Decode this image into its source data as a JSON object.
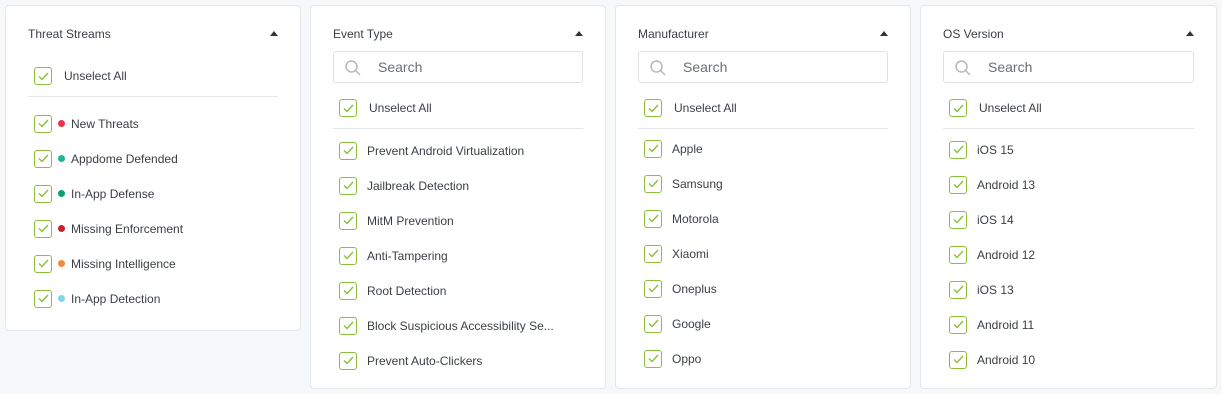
{
  "colors": {
    "checkbox_border": "#8bbf3a",
    "check": "#8bbf3a"
  },
  "panels": [
    {
      "title": "Threat Streams",
      "has_search": false,
      "select_all_label": "Unselect All",
      "items": [
        {
          "label": "New Threats",
          "dot_color": "#e8344e"
        },
        {
          "label": "Appdome Defended",
          "dot_color": "#19b98d"
        },
        {
          "label": "In-App Defense",
          "dot_color": "#0e9f73"
        },
        {
          "label": "Missing Enforcement",
          "dot_color": "#cc1f2c"
        },
        {
          "label": "Missing Intelligence",
          "dot_color": "#f08a3c"
        },
        {
          "label": "In-App Detection",
          "dot_color": "#7fd6ec"
        }
      ]
    },
    {
      "title": "Event Type",
      "has_search": true,
      "search_placeholder": "Search",
      "select_all_label": "Unselect All",
      "items": [
        {
          "label": "Prevent Android Virtualization"
        },
        {
          "label": "Jailbreak Detection"
        },
        {
          "label": "MitM Prevention"
        },
        {
          "label": "Anti-Tampering"
        },
        {
          "label": "Root Detection"
        },
        {
          "label": "Block Suspicious Accessibility Se..."
        },
        {
          "label": "Prevent Auto-Clickers"
        }
      ]
    },
    {
      "title": "Manufacturer",
      "has_search": true,
      "search_placeholder": "Search",
      "select_all_label": "Unselect All",
      "items": [
        {
          "label": "Apple"
        },
        {
          "label": "Samsung"
        },
        {
          "label": "Motorola"
        },
        {
          "label": "Xiaomi"
        },
        {
          "label": "Oneplus"
        },
        {
          "label": "Google"
        },
        {
          "label": "Oppo"
        }
      ]
    },
    {
      "title": "OS Version",
      "has_search": true,
      "search_placeholder": "Search",
      "select_all_label": "Unselect All",
      "items": [
        {
          "label": "iOS 15"
        },
        {
          "label": "Android 13"
        },
        {
          "label": "iOS 14"
        },
        {
          "label": "Android 12"
        },
        {
          "label": "iOS 13"
        },
        {
          "label": "Android 11"
        },
        {
          "label": "Android 10"
        }
      ]
    }
  ]
}
